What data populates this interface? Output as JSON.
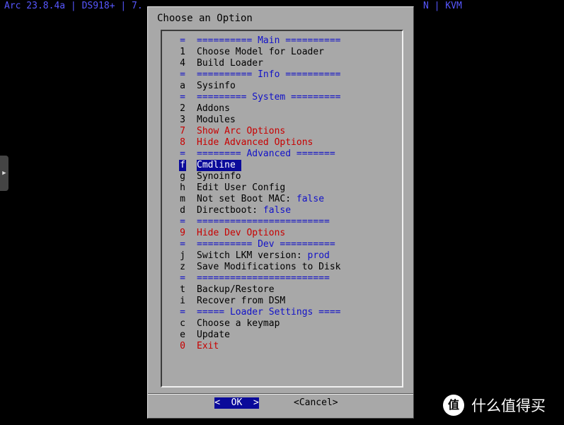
{
  "top_bar": {
    "left_text": "Arc 23.8.4a | DS918+ | 7.",
    "right_text": "N | KVM"
  },
  "dialog": {
    "title": "Choose an Option",
    "ok_label": "<  OK  >",
    "cancel_label": "<Cancel>"
  },
  "menu": {
    "items": [
      {
        "tag": "=",
        "label": "========== Main ==========",
        "kind": "sep"
      },
      {
        "tag": "1",
        "label": "Choose Model for Loader",
        "kind": "normal"
      },
      {
        "tag": "4",
        "label": "Build Loader",
        "kind": "normal"
      },
      {
        "tag": "=",
        "label": "========== Info ==========",
        "kind": "sep"
      },
      {
        "tag": "a",
        "label": "Sysinfo",
        "kind": "normal"
      },
      {
        "tag": "=",
        "label": "========= System =========",
        "kind": "sep"
      },
      {
        "tag": "2",
        "label": "Addons",
        "kind": "normal"
      },
      {
        "tag": "3",
        "label": "Modules",
        "kind": "normal"
      },
      {
        "tag": "7",
        "label": "Show Arc Options",
        "kind": "red"
      },
      {
        "tag": "8",
        "label": "Hide Advanced Options",
        "kind": "red"
      },
      {
        "tag": "=",
        "label": "======== Advanced =======",
        "kind": "sep"
      },
      {
        "tag": "f",
        "label": "Cmdline",
        "kind": "sel"
      },
      {
        "tag": "g",
        "label": "Synoinfo",
        "kind": "normal"
      },
      {
        "tag": "h",
        "label": "Edit User Config",
        "kind": "normal"
      },
      {
        "tag": "m",
        "label": "Not set Boot MAC: ",
        "value": "false",
        "kind": "normal"
      },
      {
        "tag": "d",
        "label": "Directboot: ",
        "value": "false",
        "kind": "normal"
      },
      {
        "tag": "=",
        "label": "========================",
        "kind": "sep"
      },
      {
        "tag": "9",
        "label": "Hide Dev Options",
        "kind": "red"
      },
      {
        "tag": "=",
        "label": "========== Dev ==========",
        "kind": "sep"
      },
      {
        "tag": "j",
        "label": "Switch LKM version: ",
        "value": "prod",
        "kind": "normal"
      },
      {
        "tag": "z",
        "label": "Save Modifications to Disk",
        "kind": "normal"
      },
      {
        "tag": "=",
        "label": "========================",
        "kind": "sep"
      },
      {
        "tag": "t",
        "label": "Backup/Restore",
        "kind": "normal"
      },
      {
        "tag": "i",
        "label": "Recover from DSM",
        "kind": "normal"
      },
      {
        "tag": "=",
        "label": "===== Loader Settings ====",
        "kind": "sep"
      },
      {
        "tag": "c",
        "label": "Choose a keymap",
        "kind": "normal"
      },
      {
        "tag": "e",
        "label": "Update",
        "kind": "normal"
      },
      {
        "tag": "0",
        "label": "Exit",
        "kind": "red"
      }
    ]
  },
  "side_tab": {
    "icon": "play-arrow-icon",
    "glyph": "▶"
  },
  "watermark": {
    "badge": "值",
    "text": "什么值得买"
  },
  "colors": {
    "background": "#000000",
    "dialog": "#a8a8a8",
    "separator_text": "#1212c8",
    "warning_text": "#c80000",
    "selection": "#0a0a9a",
    "topbar_text": "#5757ff"
  }
}
